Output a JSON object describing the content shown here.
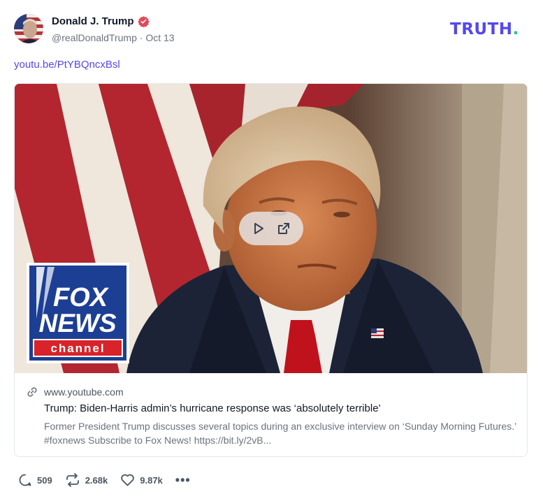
{
  "author": {
    "display_name": "Donald J. Trump",
    "handle": "@realDonaldTrump",
    "separator": "·",
    "date": "Oct 13"
  },
  "logo": {
    "text": "TRUTH",
    "dot": "."
  },
  "post": {
    "link_text": "youtu.be/PtYBQncxBsl"
  },
  "card": {
    "domain": "www.youtube.com",
    "title": "Trump: Biden-Harris admin’s hurricane response was ‘absolutely terrible’",
    "description": "Former President Trump discusses several topics during an exclusive interview on ‘Sunday Morning Futures.’ #foxnews Subscribe to Fox News! https://bit.ly/2vB...",
    "thumbnail_logo_lines": [
      "FOX",
      "NEWS",
      "channel"
    ]
  },
  "actions": {
    "replies": "509",
    "retruths": "2.68k",
    "likes": "9.87k",
    "more": "•••"
  },
  "colors": {
    "brand": "#5448ee",
    "brand_dot": "#25c2a0",
    "verified": "#e24a5a",
    "fox_red": "#d8232a",
    "fox_blue": "#1c3f94"
  },
  "icons": [
    "verified-badge-icon",
    "play-icon",
    "external-link-icon",
    "link-icon",
    "reply-icon",
    "retruth-icon",
    "like-icon",
    "more-icon"
  ]
}
